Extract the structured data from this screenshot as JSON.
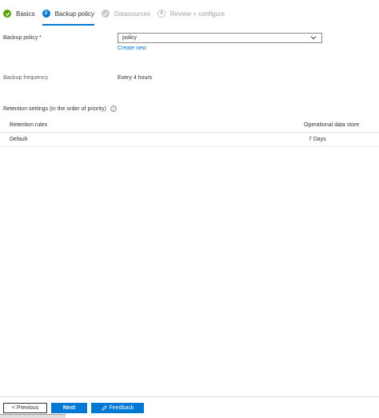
{
  "tabs": [
    {
      "label": "Basics",
      "state": "complete"
    },
    {
      "label": "Backup policy",
      "number": "2",
      "state": "active"
    },
    {
      "label": "Datasources",
      "state": "complete-disabled"
    },
    {
      "label": "Review + configure",
      "number": "4",
      "state": "disabled"
    }
  ],
  "form": {
    "backup_policy_label": "Backup policy *",
    "backup_policy_value": "policy",
    "create_new_link": "Create new",
    "backup_frequency_label": "Backup frequency",
    "backup_frequency_value": "Every 4 hours"
  },
  "retention": {
    "title": "Retention settings (in the order of priority)",
    "columns": [
      "Retention rules",
      "Operational data store"
    ],
    "rows": [
      {
        "rule": "Default",
        "value": "7 Days"
      }
    ]
  },
  "footer": {
    "previous_label": "< Previous",
    "next_label": "Next",
    "feedback_label": "Feedback"
  },
  "colors": {
    "accent": "#0078d4",
    "success": "#57a300",
    "disabled": "#a19f9d"
  }
}
